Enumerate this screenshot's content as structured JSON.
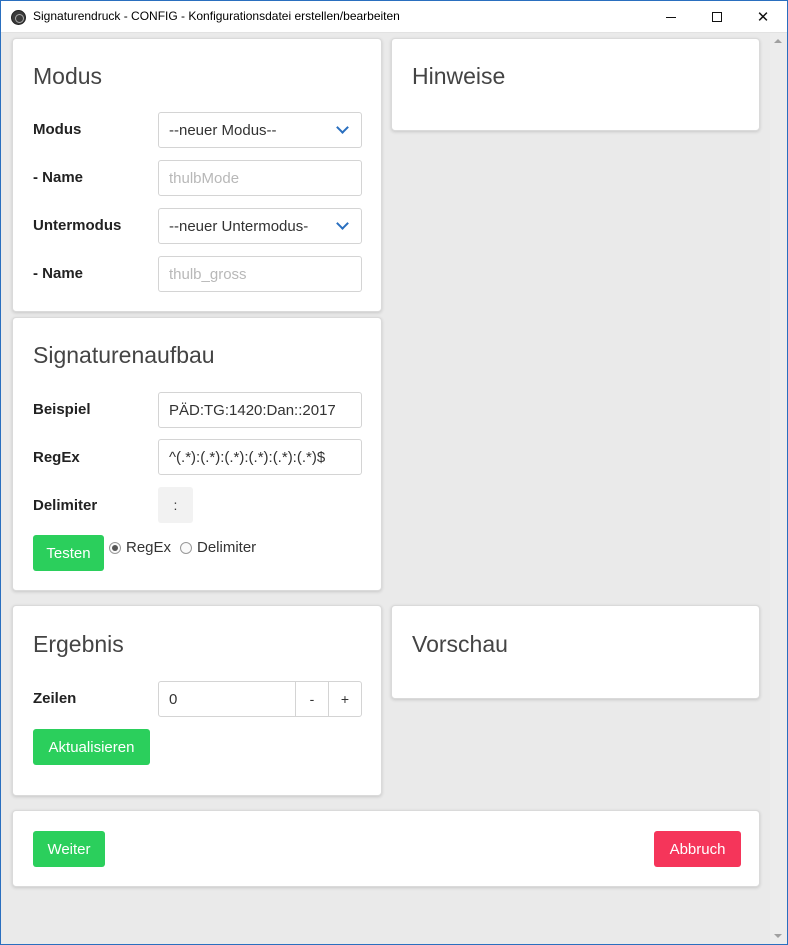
{
  "window": {
    "title": "Signaturendruck - CONFIG - Konfigurationsdatei erstellen/bearbeiten",
    "minimize_glyph": "",
    "maximize_glyph": "",
    "close_glyph": "✕"
  },
  "modus": {
    "heading": "Modus",
    "modus_label": "Modus",
    "modus_value": "--neuer Modus--",
    "name1_label": "- Name",
    "name1_placeholder": "thulbMode",
    "untermodus_label": "Untermodus",
    "untermodus_value": "--neuer Untermodus-",
    "name2_label": "- Name",
    "name2_placeholder": "thulb_gross"
  },
  "hinweise": {
    "heading": "Hinweise"
  },
  "signaturenaufbau": {
    "heading": "Signaturenaufbau",
    "beispiel_label": "Beispiel",
    "beispiel_value": "PÄD:TG:1420:Dan::2017",
    "regex_label": "RegEx",
    "regex_value": "^(.*):(.*):(.*):(.*):(.*):(.*)$",
    "delimiter_label": "Delimiter",
    "delimiter_value": ":",
    "test_button": "Testen",
    "radio_regex": "RegEx",
    "radio_delimiter": "Delimiter",
    "selected": "RegEx"
  },
  "ergebnis": {
    "heading": "Ergebnis",
    "zeilen_label": "Zeilen",
    "zeilen_value": "0",
    "minus": "-",
    "plus": "+",
    "update_button": "Aktualisieren"
  },
  "vorschau": {
    "heading": "Vorschau"
  },
  "footer": {
    "weiter_button": "Weiter",
    "abbruch_button": "Abbruch"
  },
  "colors": {
    "accent_green": "#2bcf5c",
    "cancel_red": "#f5355a",
    "chevron_blue": "#2a6fbf"
  }
}
